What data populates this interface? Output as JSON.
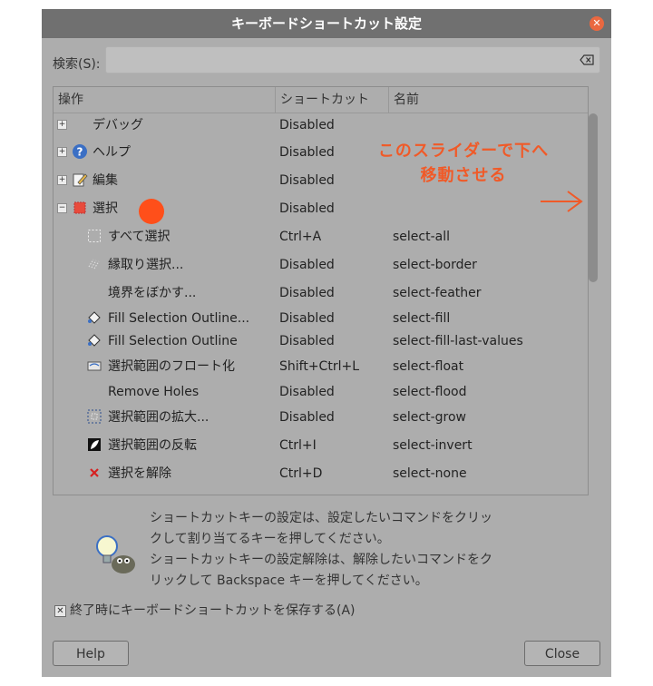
{
  "dialog": {
    "title": "キーボードショートカット設定",
    "close_icon": "close-icon"
  },
  "search": {
    "label": "検索(S):",
    "value": "",
    "clear_icon": "backspace-clear-icon"
  },
  "tree": {
    "headers": {
      "action": "操作",
      "shortcut": "ショートカット",
      "name": "名前"
    },
    "rows": [
      {
        "label": "デバッグ",
        "shortcut": "Disabled",
        "name": "",
        "expander": "+",
        "icon": "none"
      },
      {
        "label": "ヘルプ",
        "shortcut": "Disabled",
        "name": "",
        "expander": "+",
        "icon": "help-icon"
      },
      {
        "label": "編集",
        "shortcut": "Disabled",
        "name": "",
        "expander": "+",
        "icon": "edit-icon"
      },
      {
        "label": "選択",
        "shortcut": "Disabled",
        "name": "",
        "expander": "−",
        "icon": "selection-icon"
      },
      {
        "label": "すべて選択",
        "shortcut": "Ctrl+A",
        "name": "select-all",
        "icon": "select-all-icon"
      },
      {
        "label": "縁取り選択...",
        "shortcut": "Disabled",
        "name": "select-border",
        "icon": "select-border-icon"
      },
      {
        "label": "境界をぼかす...",
        "shortcut": "Disabled",
        "name": "select-feather",
        "icon": "none"
      },
      {
        "label": "Fill Selection Outline...",
        "shortcut": "Disabled",
        "name": "select-fill",
        "icon": "bucket-fill-icon"
      },
      {
        "label": "Fill Selection Outline",
        "shortcut": "Disabled",
        "name": "select-fill-last-values",
        "icon": "bucket-fill-icon"
      },
      {
        "label": "選択範囲のフロート化",
        "shortcut": "Shift+Ctrl+L",
        "name": "select-float",
        "icon": "float-selection-icon"
      },
      {
        "label": "Remove Holes",
        "shortcut": "Disabled",
        "name": "select-flood",
        "icon": "none"
      },
      {
        "label": "選択範囲の拡大...",
        "shortcut": "Disabled",
        "name": "select-grow",
        "icon": "grow-selection-icon"
      },
      {
        "label": "選択範囲の反転",
        "shortcut": "Ctrl+I",
        "name": "select-invert",
        "icon": "invert-selection-icon"
      },
      {
        "label": "選択を解除",
        "shortcut": "Ctrl+D",
        "name": "select-none",
        "icon": "select-none-icon"
      }
    ]
  },
  "annotation": {
    "line1": "このスライダーで下へ",
    "line2": "移動させる",
    "color": "#f05a28"
  },
  "tip": {
    "icon": "gimp-tip-icon",
    "line1": "ショートカットキーの設定は、設定したいコマンドをクリッ",
    "line2": "クして割り当てるキーを押してください。",
    "line3": "ショートカットキーの設定解除は、解除したいコマンドをク",
    "line4": "リックして Backspace キーを押してください。"
  },
  "save_on_exit": {
    "label": "終了時にキーボードショートカットを保存する(A)",
    "checked": true
  },
  "buttons": {
    "help": "Help",
    "close": "Close"
  }
}
